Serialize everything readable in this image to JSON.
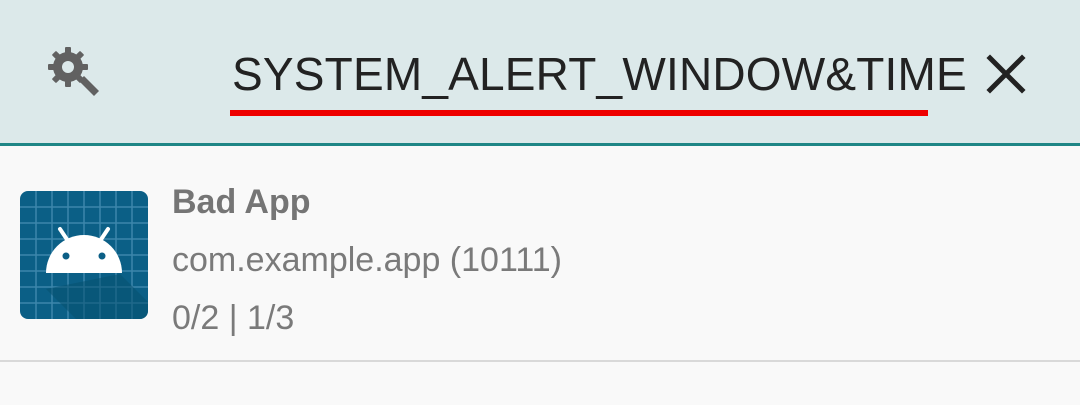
{
  "search": {
    "query": "SYSTEM_ALERT_WINDOW&TIME",
    "icon": "settings-search-icon",
    "clear_icon": "close-icon",
    "underline_color": "#ee0000",
    "bar_color": "#dce9ea",
    "border_color": "#1f8686"
  },
  "app_list": {
    "items": [
      {
        "name": "Bad App",
        "package_line": "com.example.app (10111)",
        "counts": "0/2 | 1/3",
        "icon": "android-app-icon"
      }
    ]
  }
}
